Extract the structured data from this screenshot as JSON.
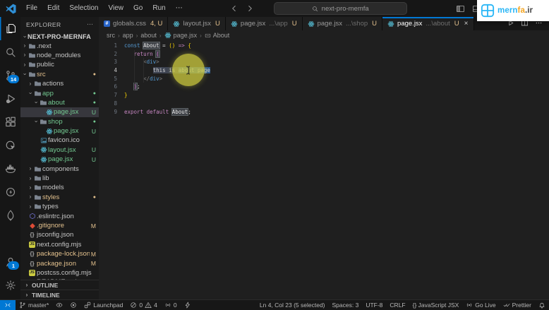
{
  "titlebar": {
    "menus": [
      "File",
      "Edit",
      "Selection",
      "View",
      "Go",
      "Run",
      "⋯"
    ],
    "search": "next-pro-memfa",
    "brand": {
      "blue": "mern",
      "orange": "fa",
      "dark": ".ir"
    }
  },
  "activity_bar": {
    "items": [
      {
        "name": "explorer",
        "icon": "files",
        "active": true
      },
      {
        "name": "search",
        "icon": "search"
      },
      {
        "name": "source-control",
        "icon": "scm",
        "badge": "14"
      },
      {
        "name": "run-debug",
        "icon": "debug"
      },
      {
        "name": "extensions",
        "icon": "ext"
      },
      {
        "name": "live-preview",
        "icon": "liveprev"
      },
      {
        "name": "docker",
        "icon": "docker"
      },
      {
        "name": "thunder-client",
        "icon": "thunder"
      },
      {
        "name": "mongodb",
        "icon": "mongo"
      }
    ],
    "bottom": [
      {
        "name": "accounts",
        "icon": "account",
        "badge": "1"
      },
      {
        "name": "settings",
        "icon": "gear"
      }
    ]
  },
  "explorer": {
    "title": "EXPLORER",
    "more": "⋯",
    "root": "NEXT-PRO-MERNFA",
    "panels": [
      "OUTLINE",
      "TIMELINE"
    ],
    "items": [
      {
        "label": ".next",
        "kind": "folder",
        "depth": 1
      },
      {
        "label": "node_modules",
        "kind": "folder",
        "depth": 1
      },
      {
        "label": "public",
        "kind": "folder",
        "depth": 1
      },
      {
        "label": "src",
        "kind": "folder",
        "depth": 1,
        "open": true,
        "color": "mod",
        "badge": "dot"
      },
      {
        "label": "actions",
        "kind": "folder",
        "depth": 2
      },
      {
        "label": "app",
        "kind": "folder",
        "depth": 2,
        "open": true,
        "color": "new",
        "badge": "dot"
      },
      {
        "label": "about",
        "kind": "folder",
        "depth": 3,
        "open": true,
        "color": "new",
        "badge": "dot"
      },
      {
        "label": "page.jsx",
        "kind": "file",
        "icon": "react",
        "depth": 4,
        "color": "new",
        "badge": "U",
        "selected": true
      },
      {
        "label": "shop",
        "kind": "folder",
        "depth": 3,
        "open": true,
        "color": "new",
        "badge": "dot"
      },
      {
        "label": "page.jsx",
        "kind": "file",
        "icon": "react",
        "depth": 4,
        "color": "new",
        "badge": "U"
      },
      {
        "label": "favicon.ico",
        "kind": "file",
        "icon": "image",
        "depth": 3
      },
      {
        "label": "layout.jsx",
        "kind": "file",
        "icon": "react",
        "depth": 3,
        "color": "new",
        "badge": "U"
      },
      {
        "label": "page.jsx",
        "kind": "file",
        "icon": "react",
        "depth": 3,
        "color": "new",
        "badge": "U"
      },
      {
        "label": "components",
        "kind": "folder",
        "depth": 2
      },
      {
        "label": "lib",
        "kind": "folder",
        "depth": 2
      },
      {
        "label": "models",
        "kind": "folder",
        "depth": 2
      },
      {
        "label": "styles",
        "kind": "folder",
        "depth": 2,
        "color": "mod",
        "badge": "dot"
      },
      {
        "label": "types",
        "kind": "folder",
        "depth": 2
      },
      {
        "label": ".eslintrc.json",
        "kind": "file",
        "icon": "eslint",
        "depth": 1
      },
      {
        "label": ".gitignore",
        "kind": "file",
        "icon": "git",
        "depth": 1,
        "color": "mod",
        "badge": "M"
      },
      {
        "label": "jsconfig.json",
        "kind": "file",
        "icon": "json",
        "depth": 1
      },
      {
        "label": "next.config.mjs",
        "kind": "file",
        "icon": "js",
        "depth": 1
      },
      {
        "label": "package-lock.json",
        "kind": "file",
        "icon": "json",
        "depth": 1,
        "color": "mod",
        "badge": "M"
      },
      {
        "label": "package.json",
        "kind": "file",
        "icon": "json",
        "depth": 1,
        "color": "mod",
        "badge": "M"
      },
      {
        "label": "postcss.config.mjs",
        "kind": "file",
        "icon": "js",
        "depth": 1
      },
      {
        "label": "README.md",
        "kind": "file",
        "icon": "md",
        "depth": 1
      }
    ]
  },
  "tabs": [
    {
      "file": "globals.css",
      "icon": "css",
      "badge": "4, U"
    },
    {
      "file": "layout.jsx",
      "icon": "react",
      "badge": "U"
    },
    {
      "file": "page.jsx",
      "dim": "...\\app",
      "icon": "react",
      "badge": "U"
    },
    {
      "file": "page.jsx",
      "dim": "...\\shop",
      "icon": "react",
      "badge": "U"
    },
    {
      "file": "page.jsx",
      "dim": "...\\about",
      "icon": "react",
      "badge": "U",
      "active": true,
      "close": "×"
    }
  ],
  "editor_actions": [
    "play",
    "split",
    "more"
  ],
  "breadcrumb": [
    {
      "label": "src"
    },
    {
      "label": "app"
    },
    {
      "label": "about"
    },
    {
      "label": "page.jsx",
      "icon": "react"
    },
    {
      "label": "About",
      "icon": "symbol"
    }
  ],
  "code": {
    "lines": [
      {
        "n": "1",
        "toks": [
          [
            "const ",
            "kw"
          ],
          [
            "About",
            "id hl"
          ],
          [
            " = ",
            "pl"
          ],
          [
            "()",
            "b1"
          ],
          [
            " ",
            "pl"
          ],
          [
            "=>",
            "kw2"
          ],
          [
            " ",
            "pl"
          ],
          [
            "{",
            "b1"
          ]
        ]
      },
      {
        "n": "2",
        "toks": [
          [
            "   ",
            "pl"
          ],
          [
            "return",
            "kw2"
          ],
          [
            " ",
            "pl"
          ],
          [
            "(",
            "b2 hl"
          ]
        ]
      },
      {
        "n": "3",
        "toks": [
          [
            "      ",
            "pl"
          ],
          [
            "<",
            "tagb"
          ],
          [
            "div",
            "tag"
          ],
          [
            ">",
            "tagb"
          ]
        ]
      },
      {
        "n": "4",
        "cur": true,
        "toks": [
          [
            "         ",
            "pl"
          ],
          [
            "this is ",
            "pl selg"
          ],
          [
            "about page",
            "pl selb"
          ]
        ]
      },
      {
        "n": "5",
        "toks": [
          [
            "      ",
            "pl"
          ],
          [
            "</",
            "tagb"
          ],
          [
            "div",
            "tag"
          ],
          [
            ">",
            "tagb"
          ]
        ]
      },
      {
        "n": "6",
        "toks": [
          [
            "   ",
            "pl"
          ],
          [
            ")",
            "b2 hl"
          ],
          [
            ";",
            "pl"
          ]
        ]
      },
      {
        "n": "7",
        "toks": [
          [
            "}",
            "b1"
          ]
        ]
      },
      {
        "n": "8",
        "toks": []
      },
      {
        "n": "9",
        "toks": [
          [
            "export",
            "kw2"
          ],
          [
            " ",
            "pl"
          ],
          [
            "default",
            "kw2"
          ],
          [
            " ",
            "pl"
          ],
          [
            "About",
            "id hl"
          ],
          [
            ";",
            "pl"
          ]
        ]
      }
    ]
  },
  "status_bar": {
    "left": [
      {
        "name": "remote-indicator",
        "accent": true,
        "parts": [
          {
            "icon": "remote"
          }
        ]
      },
      {
        "name": "git-branch",
        "parts": [
          {
            "icon": "branch"
          },
          {
            "text": "master*"
          }
        ]
      },
      {
        "name": "gitlens-eye",
        "parts": [
          {
            "icon": "eye"
          }
        ]
      },
      {
        "name": "gitlens-target",
        "parts": [
          {
            "icon": "target"
          }
        ]
      },
      {
        "name": "launchpad",
        "parts": [
          {
            "icon": "link"
          },
          {
            "text": "Launchpad"
          }
        ]
      },
      {
        "name": "problems",
        "parts": [
          {
            "icon": "error"
          },
          {
            "text": "0"
          },
          {
            "icon": "warn"
          },
          {
            "text": "4"
          }
        ]
      },
      {
        "name": "radio-count",
        "parts": [
          {
            "icon": "broadcast"
          },
          {
            "text": "0"
          }
        ]
      },
      {
        "name": "lightning",
        "parts": [
          {
            "icon": "zap"
          }
        ]
      }
    ],
    "right": [
      {
        "name": "cursor-position",
        "parts": [
          {
            "text": "Ln 4, Col 23 (5 selected)"
          }
        ]
      },
      {
        "name": "indentation",
        "parts": [
          {
            "text": "Spaces: 3"
          }
        ]
      },
      {
        "name": "encoding",
        "parts": [
          {
            "text": "UTF-8"
          }
        ]
      },
      {
        "name": "eol",
        "parts": [
          {
            "text": "CRLF"
          }
        ]
      },
      {
        "name": "language-mode",
        "parts": [
          {
            "text": "{} JavaScript JSX"
          }
        ]
      },
      {
        "name": "go-live",
        "parts": [
          {
            "icon": "broadcast"
          },
          {
            "text": "Go Live"
          }
        ]
      },
      {
        "name": "prettier",
        "parts": [
          {
            "icon": "check2"
          },
          {
            "text": "Prettier"
          }
        ]
      },
      {
        "name": "notifications",
        "parts": [
          {
            "icon": "bell"
          }
        ]
      }
    ]
  }
}
